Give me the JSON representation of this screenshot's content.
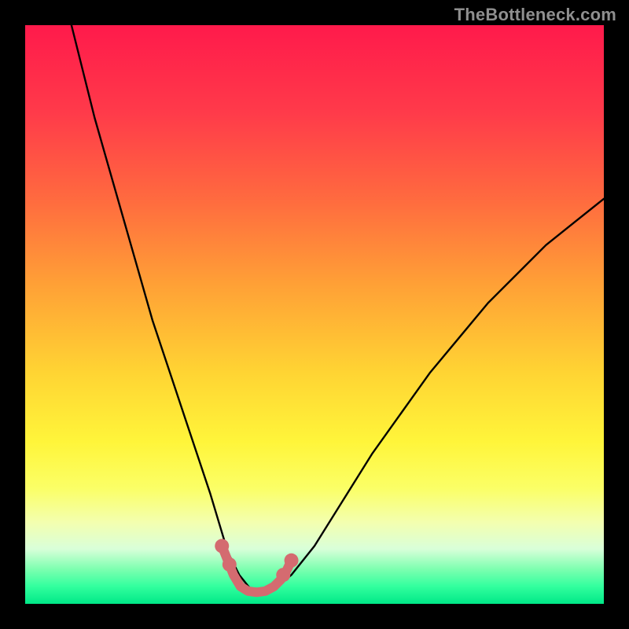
{
  "watermark": "TheBottleneck.com",
  "chart_data": {
    "type": "line",
    "title": "",
    "xlabel": "",
    "ylabel": "",
    "xlim": [
      0,
      100
    ],
    "ylim": [
      0,
      100
    ],
    "grid": false,
    "legend": false,
    "background_gradient_stops": [
      {
        "offset": 0.0,
        "color": "#ff1a4b"
      },
      {
        "offset": 0.15,
        "color": "#ff3a4a"
      },
      {
        "offset": 0.3,
        "color": "#ff6a3f"
      },
      {
        "offset": 0.45,
        "color": "#ffa136"
      },
      {
        "offset": 0.6,
        "color": "#ffd433"
      },
      {
        "offset": 0.72,
        "color": "#fff53a"
      },
      {
        "offset": 0.8,
        "color": "#fbff66"
      },
      {
        "offset": 0.86,
        "color": "#f3ffb0"
      },
      {
        "offset": 0.905,
        "color": "#d9ffd9"
      },
      {
        "offset": 0.94,
        "color": "#7dffb0"
      },
      {
        "offset": 0.97,
        "color": "#32ff9e"
      },
      {
        "offset": 1.0,
        "color": "#00e888"
      }
    ],
    "series": [
      {
        "name": "bottleneck-curve",
        "stroke": "#000000",
        "stroke_width": 2.4,
        "x": [
          8,
          10,
          12,
          14,
          16,
          18,
          20,
          22,
          24,
          26,
          28,
          30,
          32,
          33.5,
          35,
          37,
          39,
          41,
          43,
          46,
          50,
          55,
          60,
          65,
          70,
          75,
          80,
          85,
          90,
          95,
          100
        ],
        "y": [
          100,
          92,
          84,
          77,
          70,
          63,
          56,
          49,
          43,
          37,
          31,
          25,
          19,
          14,
          9,
          5,
          2.5,
          2,
          2.5,
          5,
          10,
          18,
          26,
          33,
          40,
          46,
          52,
          57,
          62,
          66,
          70
        ]
      },
      {
        "name": "highlight-band",
        "stroke": "#d46b70",
        "stroke_width": 12,
        "x": [
          34.0,
          35.0,
          36.0,
          37.2,
          38.5,
          40.0,
          41.5,
          43.0,
          44.2,
          45.2,
          46.0
        ],
        "y": [
          10.0,
          7.5,
          5.0,
          3.0,
          2.2,
          2.0,
          2.2,
          3.0,
          4.2,
          5.8,
          7.5
        ]
      }
    ],
    "markers": [
      {
        "series": "highlight-band",
        "x": 34.0,
        "y": 10.0,
        "r": 9
      },
      {
        "series": "highlight-band",
        "x": 35.3,
        "y": 6.8,
        "r": 9
      },
      {
        "series": "highlight-band",
        "x": 44.6,
        "y": 5.0,
        "r": 9
      },
      {
        "series": "highlight-band",
        "x": 46.0,
        "y": 7.5,
        "r": 9
      }
    ]
  }
}
